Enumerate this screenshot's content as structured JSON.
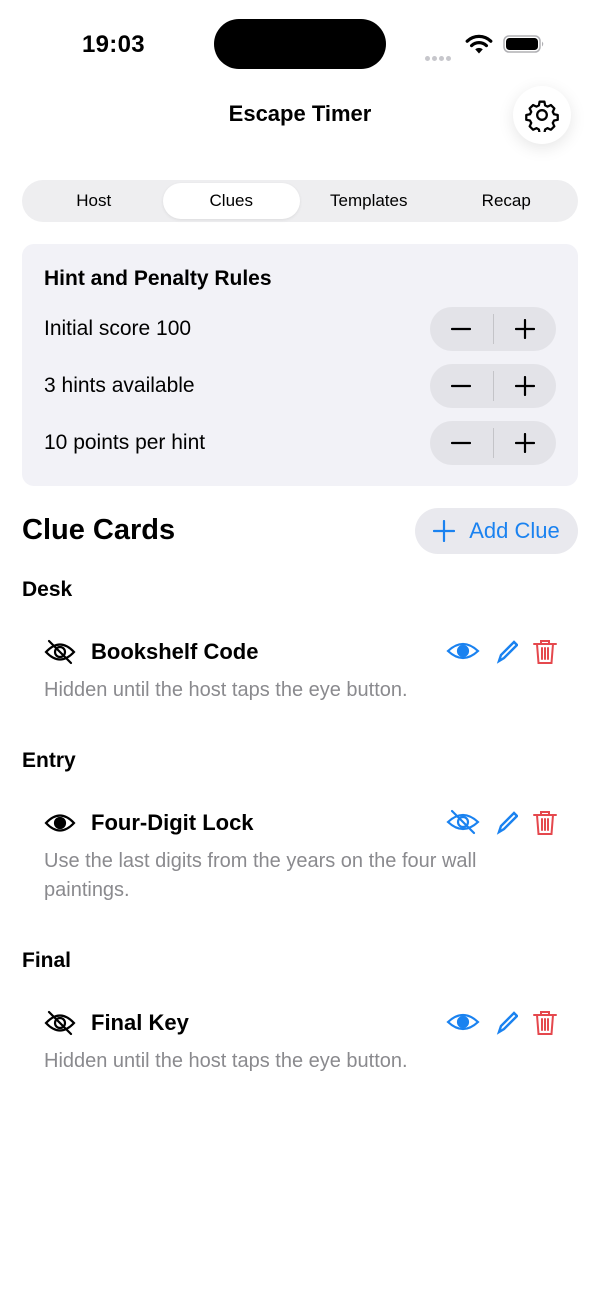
{
  "status": {
    "time": "19:03"
  },
  "nav": {
    "title": "Escape Timer",
    "settings_icon": "gear-icon"
  },
  "tabs": [
    {
      "label": "Host",
      "active": false
    },
    {
      "label": "Clues",
      "active": true
    },
    {
      "label": "Templates",
      "active": false
    },
    {
      "label": "Recap",
      "active": false
    }
  ],
  "rules": {
    "title": "Hint and Penalty Rules",
    "rows": [
      {
        "label": "Initial score 100"
      },
      {
        "label": "3 hints available"
      },
      {
        "label": "10 points per hint"
      }
    ]
  },
  "clue_cards": {
    "title": "Clue Cards",
    "add_label": "Add Clue",
    "groups": [
      {
        "label": "Desk",
        "clue": {
          "title": "Bookshelf Code",
          "revealed": false,
          "body": "Hidden until the host taps the eye button."
        }
      },
      {
        "label": "Entry",
        "clue": {
          "title": "Four-Digit Lock",
          "revealed": true,
          "body": "Use the last digits from the years on the four wall paintings."
        }
      },
      {
        "label": "Final",
        "clue": {
          "title": "Final Key",
          "revealed": false,
          "body": "Hidden until the host taps the eye button."
        }
      }
    ]
  },
  "colors": {
    "accent": "#1a82f0",
    "destructive": "#e5484d",
    "secondary_text": "#8a8a8e"
  }
}
